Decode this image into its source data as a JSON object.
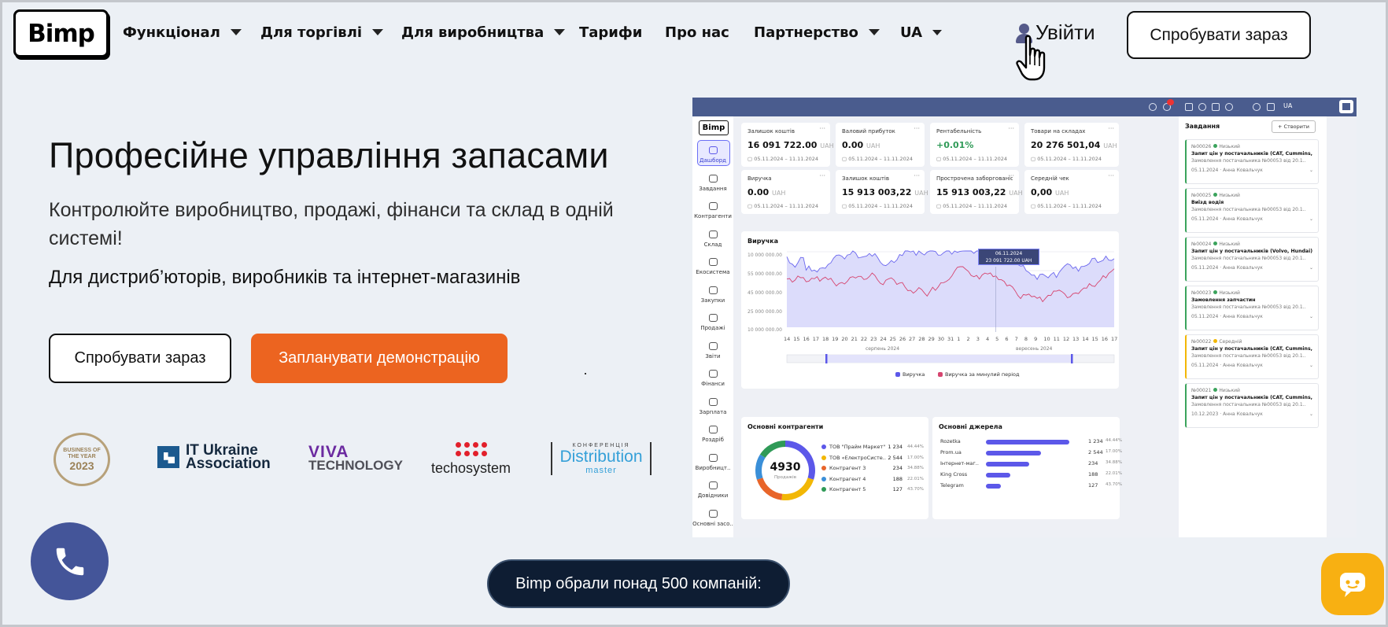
{
  "header": {
    "logo": "Bimp",
    "nav": [
      {
        "label": "Функціонал",
        "has_dropdown": true
      },
      {
        "label": "Для торгівлі",
        "has_dropdown": true
      },
      {
        "label": "Для виробництва",
        "has_dropdown": true
      },
      {
        "label": "Тарифи",
        "has_dropdown": false
      },
      {
        "label": "Про нас",
        "has_dropdown": false
      },
      {
        "label": "Партнерство",
        "has_dropdown": true
      },
      {
        "label": "UA",
        "has_dropdown": true
      }
    ],
    "login_label": "Увійти",
    "cta_label": "Спробувати зараз"
  },
  "hero": {
    "title": "Професійне управління запасами",
    "subtitle": "Контролюйте виробництво, продажі, фінанси та склад в одній системі!",
    "audience": "Для дистриб’юторів, виробників та інтернет-магазинів",
    "btn_try": "Спробувати зараз",
    "btn_demo": "Запланувати демонстрацію"
  },
  "partners": {
    "boty": {
      "l1": "BUSINESS OF",
      "l2": "THE YEAR",
      "year": "2023"
    },
    "itua": {
      "l1": "IT Ukraine",
      "l2": "Association"
    },
    "viva": {
      "l1": "VIVA",
      "l2": "TECHNOLOGY"
    },
    "techo": "techosystem",
    "distr": {
      "l0": "КОНФЕРЕНЦІЯ",
      "l1": "Distribution",
      "l2": "master"
    }
  },
  "bottom": {
    "pill": "Bimp обрали понад 500 компаній:"
  },
  "colors": {
    "accent_orange": "#ec6420",
    "phone_blue": "#445599",
    "chat_yellow": "#f8b012",
    "pill_dark": "#0e1d33",
    "dash_topbar": "#4a5c8e"
  },
  "dashboard": {
    "topbar_lang": "UA",
    "sidebar_logo": "Bimp",
    "sidebar": [
      "Дашборд",
      "Завдання",
      "Контрагенти",
      "Склад",
      "Екосистема",
      "Закупки",
      "Продажі",
      "Звіти",
      "Фінанси",
      "Зарплата",
      "Роздріб",
      "Виробницт..",
      "Довідники",
      "Основні засо.."
    ],
    "kpis": [
      {
        "label": "Залишок коштів",
        "value": "16 091 722.00",
        "unit": "UAH",
        "date": "05.11.2024 – 11.11.2024"
      },
      {
        "label": "Валовий прибуток",
        "value": "0.00",
        "unit": "UAH",
        "date": "05.11.2024 – 11.11.2024"
      },
      {
        "label": "Рентабельність",
        "value": "+0.01%",
        "unit": "",
        "date": "05.11.2024 – 11.11.2024"
      },
      {
        "label": "Товари на складах",
        "value": "20 276 501,04",
        "unit": "UAH",
        "date": "05.11.2024 – 11.11.2024"
      },
      {
        "label": "Виручка",
        "value": "0.00",
        "unit": "UAH",
        "date": "05.11.2024 – 11.11.2024"
      },
      {
        "label": "Залишок коштів",
        "value": "15 913 003,22",
        "unit": "UAH",
        "date": "05.11.2024 – 11.11.2024"
      },
      {
        "label": "Прострочена заборгованість ві..",
        "value": "15 913 003,22",
        "unit": "UAH",
        "date": "05.11.2024 – 11.11.2024"
      },
      {
        "label": "Середній чек",
        "value": "0,00",
        "unit": "UAH",
        "date": "05.11.2024 – 11.11.2024"
      }
    ],
    "chart": {
      "title": "Виручка",
      "y_ticks": [
        "10 000 000.00",
        "55 000 000.00",
        "45 000 000.00",
        "25 000 000.00",
        "10 000 000.00"
      ],
      "x_ticks": [
        "14",
        "15",
        "16",
        "17",
        "18",
        "19",
        "20",
        "21",
        "22",
        "23",
        "24",
        "25",
        "26",
        "27",
        "28",
        "29",
        "30",
        "31",
        "1",
        "2",
        "3",
        "4",
        "5",
        "6",
        "7",
        "8",
        "9",
        "10",
        "11",
        "12",
        "13",
        "14",
        "15",
        "16",
        "17"
      ],
      "months": [
        "серпень 2024",
        "вересень 2024"
      ],
      "tooltip_date": "06.11.2024",
      "tooltip_value": "23 091 722.00 UAH",
      "legend": [
        "Виручка",
        "Виручка за минулий період"
      ]
    },
    "counterparties": {
      "title": "Основні контрагенти",
      "total": "4930",
      "total_label": "Продажів",
      "rows": [
        {
          "name": "ТОВ \"Прайм Маркет\"",
          "value": "1 234",
          "pct": "44.44%",
          "color": "#5c58e9"
        },
        {
          "name": "ТОВ «ЕлектроСисте..",
          "value": "2 544",
          "pct": "17.00%",
          "color": "#f2b705"
        },
        {
          "name": "Контрагент 3",
          "value": "234",
          "pct": "34.88%",
          "color": "#e8652a"
        },
        {
          "name": "Контрагент 4",
          "value": "188",
          "pct": "22.01%",
          "color": "#3a8fd8"
        },
        {
          "name": "Контрагент 5",
          "value": "127",
          "pct": "43.70%",
          "color": "#2f9a57"
        }
      ]
    },
    "sources": {
      "title": "Основні джерела",
      "rows": [
        {
          "name": "Rozetka",
          "value": "1 234",
          "pct": "44.44%",
          "frac": 0.85
        },
        {
          "name": "Prom.ua",
          "value": "2 544",
          "pct": "17.00%",
          "frac": 0.56
        },
        {
          "name": "Інтернет-маг..",
          "value": "234",
          "pct": "34.88%",
          "frac": 0.44
        },
        {
          "name": "King Cross",
          "value": "188",
          "pct": "22.01%",
          "frac": 0.25
        },
        {
          "name": "Telegram",
          "value": "127",
          "pct": "43.70%",
          "frac": 0.15
        }
      ]
    },
    "tasks": {
      "title": "Завдання",
      "create_label": "+ Створити",
      "items": [
        {
          "id": "№00026",
          "prio": "Низький",
          "title": "Запит цін у постачальників (CAT, Cummins, C..",
          "meta": "Замовлення постачальника №00053 від 20.1..",
          "date": "05.11.2024",
          "owner": "Анна Ковальчук",
          "color": "green"
        },
        {
          "id": "№00025",
          "prio": "Низький",
          "title": "Виїзд водія",
          "meta": "Замовлення постачальника №00053 від 20.1..",
          "date": "05.11.2024",
          "owner": "Анна Ковальчук",
          "color": "green"
        },
        {
          "id": "№00024",
          "prio": "Низький",
          "title": "Запит цін у постачальників (Volvo, Hundai)",
          "meta": "Замовлення постачальника №00053 від 20.1..",
          "date": "05.11.2024",
          "owner": "Анна Ковальчук",
          "color": "green"
        },
        {
          "id": "№00023",
          "prio": "Низький",
          "title": "Замовлення запчастин",
          "meta": "Замовлення постачальника №00053 від 20.1..",
          "date": "05.11.2024",
          "owner": "Анна Ковальчук",
          "color": "green"
        },
        {
          "id": "№00022",
          "prio": "Середній",
          "title": "Запит цін у постачальників (CAT, Cummins, C..",
          "meta": "Замовлення постачальника №00053 від 20.1..",
          "date": "05.11.2024",
          "owner": "Анна Ковальчук",
          "color": "yellow"
        },
        {
          "id": "№00021",
          "prio": "Низький",
          "title": "Запит цін у постачальників (CAT, Cummins, C..",
          "meta": "Замовлення постачальника №00053 від 20.1..",
          "date": "10.12.2023",
          "owner": "Анна Ковальчук",
          "color": "green"
        }
      ]
    }
  }
}
